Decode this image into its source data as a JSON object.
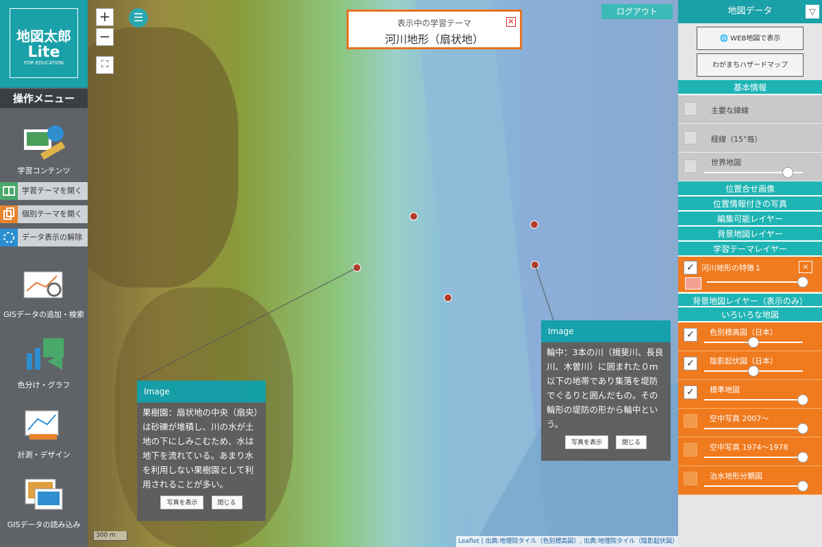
{
  "logo": {
    "line1": "地図太郎",
    "line2": "Lite",
    "line3": "FOR EDUCATION"
  },
  "sidebar": {
    "title": "操作メニュー",
    "items": [
      {
        "label": "学習コンテンツ"
      },
      {
        "label": "GISデータの追加・検索"
      },
      {
        "label": "色分け・グラフ"
      },
      {
        "label": "計測・デザイン"
      },
      {
        "label": "GISデータの読み込み"
      }
    ],
    "sub_items": [
      {
        "label": "学習テーマを開く"
      },
      {
        "label": "個別テーマを開く"
      },
      {
        "label": "データ表示の解除"
      }
    ]
  },
  "map": {
    "zoom_in": "+",
    "zoom_out": "−",
    "logout": "ログアウト",
    "theme_label": "表示中の学習テーマ",
    "theme_value": "河川地形（扇状地）",
    "scale": "300 m",
    "attribution": "Leaflet | 出典:地理院タイル（色別標高図）, 出典:地理院タイル（陰影起伏図）, 出典:地理院タイル（標準地図）"
  },
  "popup_left": {
    "header": "Image",
    "body": "果樹園：扇状地の中央（扇央）は砂礫が堆積し、川の水が土地の下にしみこむため、水は地下を流れている。あまり水を利用しない果樹園として利用されることが多い。",
    "show_photo": "写真を表示",
    "close": "閉じる"
  },
  "popup_right": {
    "header": "Image",
    "body": "輪中：3本の川（揖斐川、長良川、木曽川）に囲まれた０ｍ以下の地帯であり集落を堤防でぐるりと囲んだもの。その輪形の堤防の形から輪中という。",
    "show_photo": "写真を表示",
    "close": "閉じる"
  },
  "right_panel": {
    "title": "地図データ",
    "web_map": "WEB地図で表示",
    "hazard": "わがまちハザードマップ",
    "sec_basic": "基本情報",
    "basic": [
      {
        "label": "主要な緯線"
      },
      {
        "label": "経線（15°毎）"
      },
      {
        "label": "世界地図",
        "slider": 0.85
      }
    ],
    "sec_align": "位置合せ画像",
    "sec_photo": "位置情報付きの写真",
    "sec_edit": "編集可能レイヤー",
    "sec_bg": "背景地図レイヤー",
    "sec_theme": "学習テーマレイヤー",
    "theme_layer": {
      "label": "河川地形の特徴１",
      "close": "×",
      "slider": 1.0
    },
    "sec_bg_only": "背景地図レイヤー（表示のみ）",
    "sec_various": "いろいろな地図",
    "layers": [
      {
        "label": "色別標高図（日本）",
        "checked": true,
        "slider": 0.5
      },
      {
        "label": "陰影起伏図（日本）",
        "checked": true,
        "slider": 0.5
      },
      {
        "label": "標準地図",
        "checked": true,
        "slider": 1.0
      },
      {
        "label": "空中写真 2007～",
        "checked": false,
        "slider": 1.0
      },
      {
        "label": "空中写真 1974～1978",
        "checked": false,
        "slider": 1.0
      },
      {
        "label": "治水地形分類図",
        "checked": false,
        "slider": 1.0
      }
    ]
  },
  "colors": {
    "teal": "#1aa0a8",
    "orange": "#f07a1e",
    "sidebar": "#5f6368"
  }
}
